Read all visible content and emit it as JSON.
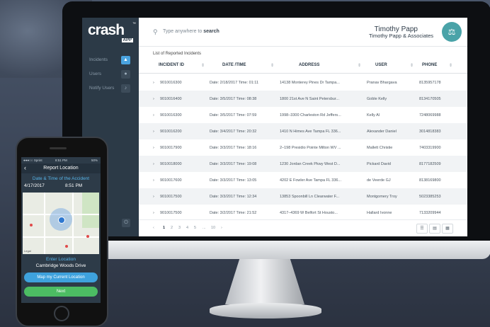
{
  "logo": {
    "word": "crash",
    "sub": "APP",
    "tm": "™"
  },
  "search": {
    "prefix": "Type anywhere to ",
    "bold": "search"
  },
  "user": {
    "name": "Timothy Papp",
    "company": "Timothy Papp & Associates"
  },
  "sidebar": {
    "items": [
      {
        "label": "Incidents"
      },
      {
        "label": "Users"
      },
      {
        "label": "Notify Users"
      }
    ]
  },
  "list_title": "List of Reported Incidents",
  "table": {
    "headers": [
      "INCIDENT ID",
      "DATE /TIME",
      "ADDRESS",
      "USER",
      "PHONE"
    ],
    "rows": [
      [
        "9010016300",
        "Date: 2/18/2017 Time: 01:11",
        "14138 Monterey Pines Dr Tampa...",
        "Pranav Bhargava",
        "8135957178"
      ],
      [
        "9010016400",
        "Date: 3/5/2017 Time: 08:38",
        "1800 21st Ave N Saint Petersbur...",
        "Goble Kelly",
        "8134170505"
      ],
      [
        "9010016300",
        "Date: 3/5/2017 Time: 07:59",
        "1998–3300 Charleston Rd Jeffers...",
        "Kelly Al",
        "7248069988"
      ],
      [
        "9010016200",
        "Date: 3/4/2017 Time: 20:32",
        "1410 N Himes Ave Tampa FL 336...",
        "Alexander Daniel",
        "3014818383"
      ],
      [
        "9010017900",
        "Date: 3/3/2017 Time: 18:16",
        "2–198 Presidio Pointe Milton WV ...",
        "Mallett Christie",
        "7403319900"
      ],
      [
        "9010018000",
        "Date: 3/3/2017 Time: 19:08",
        "1230 Jordan Creek Pkwy West D...",
        "Pickard David",
        "8177182509"
      ],
      [
        "9010017600",
        "Date: 3/3/2017 Time: 13:05",
        "4202 E Fowler Ave Tampa FL 336...",
        "de Veerde GJ",
        "8138169800"
      ],
      [
        "9010017500",
        "Date: 3/3/2017 Time: 12:34",
        "13853 Spoonbill Ln Clearwater F...",
        "Montgomery Troy",
        "5023385253"
      ],
      [
        "9010017500",
        "Date: 3/2/2017 Time: 21:52",
        "4317–4369 W Belfort St Housto...",
        "Hallard Ivonne",
        "7133209944"
      ]
    ]
  },
  "pager": {
    "prev": "‹",
    "pages": [
      "1",
      "2",
      "3",
      "4",
      "5"
    ],
    "ellipsis": "...",
    "last": "10",
    "next": "›"
  },
  "phone": {
    "carrier": "●●●○○ Sprint",
    "status_time": "8:51 PM",
    "battery": "50%",
    "title": "Report Location",
    "dt_label": "Date & Time of the Accident",
    "date": "4/17/2017",
    "time": "8:51 PM",
    "loc_label": "Enter Location",
    "location": "Cambridge Woods Drive",
    "btn_map": "Map my Current Location",
    "btn_next": "Next",
    "map_brand": "Legal"
  },
  "colors": {
    "accent": "#4aa3df",
    "sidebar": "#2c3a47",
    "green": "#4cbd63"
  }
}
